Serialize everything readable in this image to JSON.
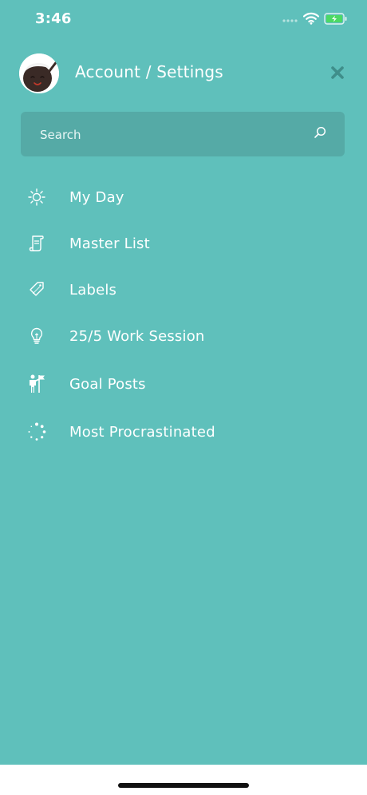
{
  "status_bar": {
    "time": "3:46"
  },
  "header": {
    "title": "Account / Settings",
    "close_icon": "close-icon"
  },
  "search": {
    "placeholder": "Search",
    "icon": "search-icon"
  },
  "menu": {
    "items": [
      {
        "label": "My Day",
        "icon": "sun-icon"
      },
      {
        "label": "Master List",
        "icon": "scroll-list-icon"
      },
      {
        "label": "Labels",
        "icon": "tag-icon"
      },
      {
        "label": "25/5 Work Session",
        "icon": "lightbulb-icon"
      },
      {
        "label": "Goal Posts",
        "icon": "person-flag-icon"
      },
      {
        "label": "Most Procrastinated",
        "icon": "loading-dots-icon"
      }
    ]
  },
  "colors": {
    "background": "#5fc0bb",
    "search_background": "#55aaa6",
    "text": "#ffffff",
    "close_icon": "#3f8e8a"
  }
}
